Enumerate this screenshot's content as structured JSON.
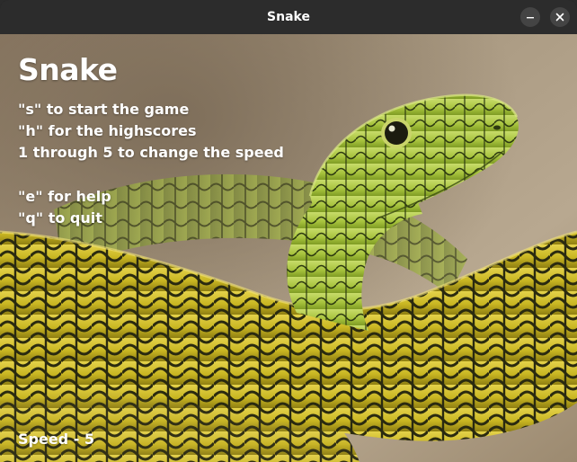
{
  "window": {
    "title": "Snake",
    "minimize_icon": "minimize-icon",
    "close_icon": "close-icon"
  },
  "menu": {
    "title": "Snake",
    "instructions": [
      "\"s\" to start the game",
      "\"h\" for the highscores",
      "1 through 5 to change the speed",
      "\"e\" for help",
      "\"q\" to quit"
    ],
    "speed": "Speed - 5"
  },
  "colors": {
    "titlebar": "#2c2c2c",
    "text": "#ffffff",
    "snake_yellow": "#d9c52a",
    "snake_green": "#a8c83a"
  }
}
